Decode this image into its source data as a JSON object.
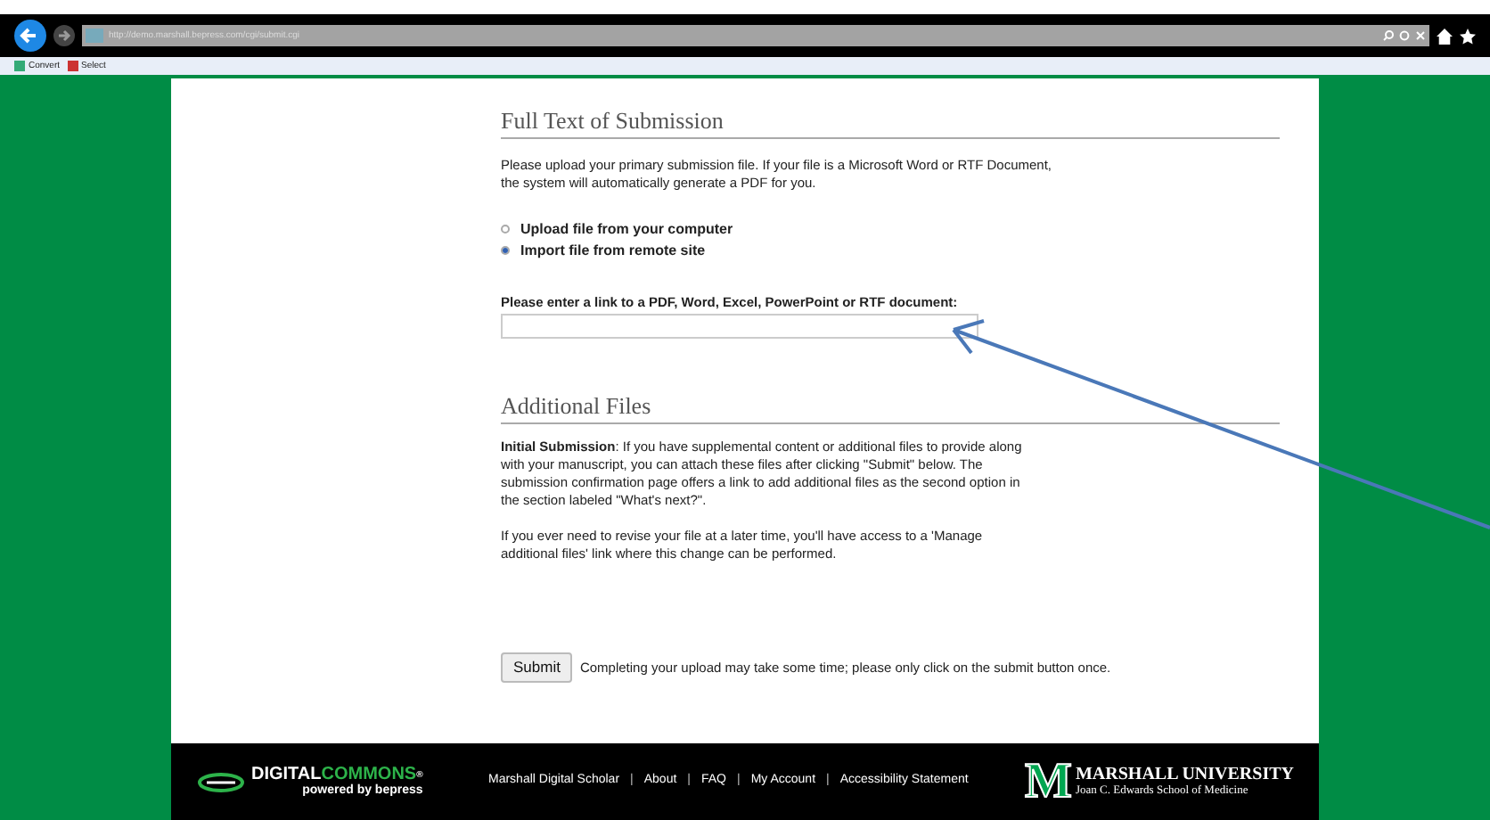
{
  "browser": {
    "address": "http://demo.marshall.bepress.com/cgi/submit.cgi",
    "toolbar": [
      "Convert",
      "Select"
    ]
  },
  "full_text": {
    "heading": "Full Text of Submission",
    "intro": "Please upload your primary submission file. If your file is a Microsoft Word or RTF Document, the system will automatically generate a PDF for you.",
    "options": [
      {
        "label": "Upload file from your computer",
        "selected": false
      },
      {
        "label": "Import file from remote site",
        "selected": true
      }
    ],
    "link_label": "Please enter a link to a PDF, Word, Excel, PowerPoint or RTF document:"
  },
  "additional_files": {
    "heading": "Additional Files",
    "paragraphs": [
      "**Initial Submission**: If you have supplemental content or additional files to provide along with your manuscript, you can attach these files after clicking \"Submit\" below. The submission confirmation page offers a link to add additional files as the second option in the section labeled \"What's next?\".",
      "If you ever need to revise your file at a later time, you'll have access to a 'Manage additional files' link where this change can be performed."
    ]
  },
  "submit": {
    "button": "Submit",
    "note": "Completing your upload may take some time; please only click on the submit button once."
  },
  "footer": {
    "logo": {
      "word1": "DIGITAL",
      "word2": "COMMONS",
      "mark": "®",
      "tagline": "powered by bepress"
    },
    "items": [
      {
        "kind": "link",
        "text": "Marshall Digital Scholar"
      },
      {
        "kind": "separator",
        "text": "|"
      },
      {
        "kind": "link",
        "text": "About"
      },
      {
        "kind": "separator",
        "text": "|"
      },
      {
        "kind": "link",
        "text": "FAQ"
      },
      {
        "kind": "separator",
        "text": "|"
      },
      {
        "kind": "link",
        "text": "My Account"
      },
      {
        "kind": "separator",
        "text": "|"
      },
      {
        "kind": "link",
        "text": "Accessibility Statement"
      }
    ],
    "university": {
      "letter": "M",
      "name": "MARSHALL UNIVERSITY",
      "school": "Joan C. Edwards School of Medicine"
    }
  }
}
